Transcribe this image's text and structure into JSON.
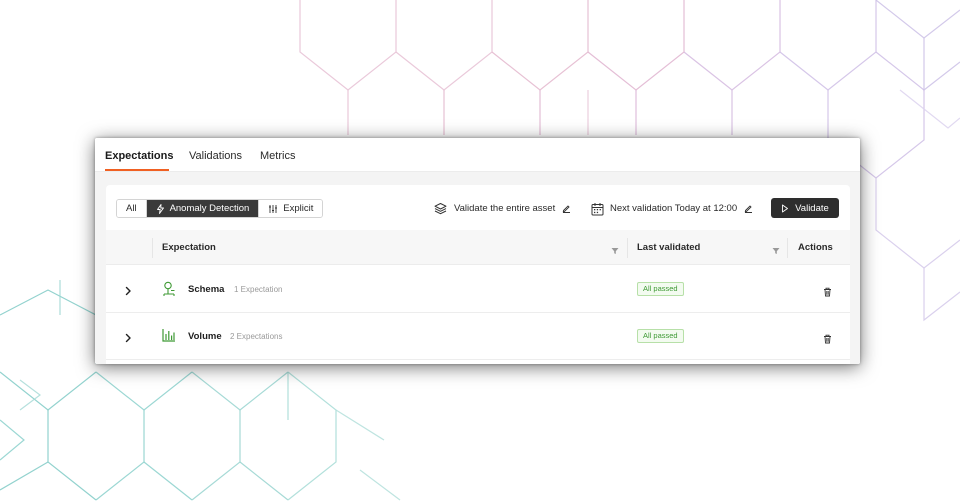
{
  "tabs": [
    {
      "label": "Expectations",
      "active": true
    },
    {
      "label": "Validations",
      "active": false
    },
    {
      "label": "Metrics",
      "active": false
    }
  ],
  "filters": {
    "all_label": "All",
    "anomaly_label": "Anomaly Detection",
    "explicit_label": "Explicit",
    "selected": "Anomaly Detection"
  },
  "toolbar": {
    "validate_scope_label": "Validate the entire asset",
    "schedule_label": "Next validation Today at 12:00",
    "validate_button_label": "Validate"
  },
  "table": {
    "columns": {
      "expectation": "Expectation",
      "last_validated": "Last validated",
      "actions": "Actions"
    },
    "rows": [
      {
        "name": "Schema",
        "count": "1 Expectation",
        "status": "All passed",
        "icon": "schema-icon"
      },
      {
        "name": "Volume",
        "count": "2 Expectations",
        "status": "All passed",
        "icon": "volume-chart-icon"
      }
    ]
  },
  "colors": {
    "accent": "#f06022",
    "dark_button": "#2e2e2e",
    "success_green": "#3f9a35",
    "pattern_teal": "#7cc8c4",
    "pattern_pink": "#e3b8cf",
    "pattern_lavender": "#cdbde6"
  }
}
